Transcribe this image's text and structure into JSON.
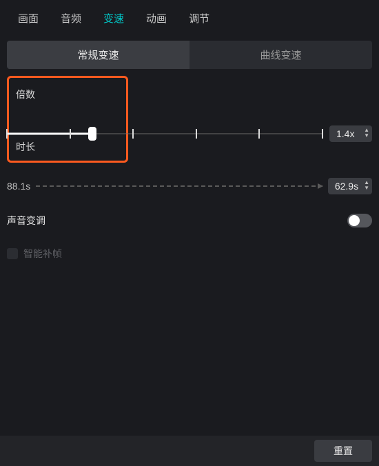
{
  "top_tabs": {
    "picture": "画面",
    "audio": "音频",
    "speed": "变速",
    "animation": "动画",
    "adjust": "调节"
  },
  "mode_tabs": {
    "normal": "常规变速",
    "curve": "曲线变速"
  },
  "speed_section": {
    "label": "倍数",
    "value_display": "1.4x"
  },
  "duration_section": {
    "label": "时长",
    "original": "88.1s",
    "result": "62.9s"
  },
  "pitch_toggle": {
    "label": "声音变调",
    "state": "off"
  },
  "smart_interp": {
    "label": "智能补帧"
  },
  "footer": {
    "reset": "重置"
  }
}
